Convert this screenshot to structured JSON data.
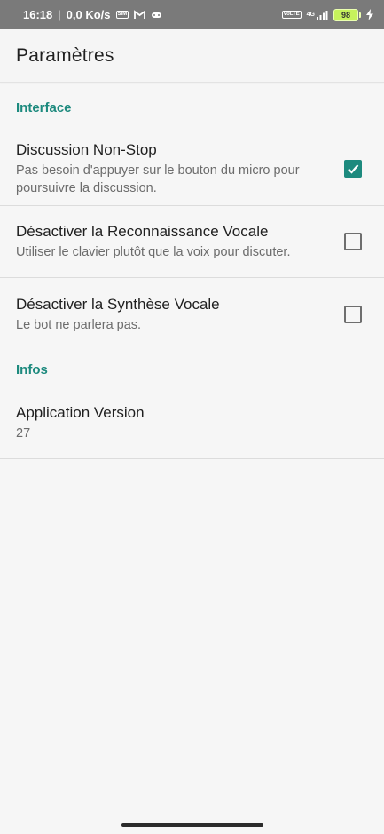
{
  "status_bar": {
    "time": "16:18",
    "net_speed": "0,0 Ko/s",
    "network": "4G",
    "battery": "98"
  },
  "app_bar": {
    "title": "Paramètres"
  },
  "sections": {
    "interface": {
      "header": "Interface",
      "items": [
        {
          "title": "Discussion Non-Stop",
          "summary": "Pas besoin d'appuyer sur le bouton du micro pour poursuivre la discussion.",
          "checked": true
        },
        {
          "title": "Désactiver la Reconnaissance Vocale",
          "summary": "Utiliser le clavier plutôt que la voix pour discuter.",
          "checked": false
        },
        {
          "title": "Désactiver la Synthèse Vocale",
          "summary": "Le bot ne parlera pas.",
          "checked": false
        }
      ]
    },
    "infos": {
      "header": "Infos",
      "items": [
        {
          "title": "Application Version",
          "summary": "27"
        }
      ]
    }
  },
  "colors": {
    "accent": "#1d8a7e",
    "status_bar": "#7a7a7a",
    "background": "#f6f6f6"
  }
}
